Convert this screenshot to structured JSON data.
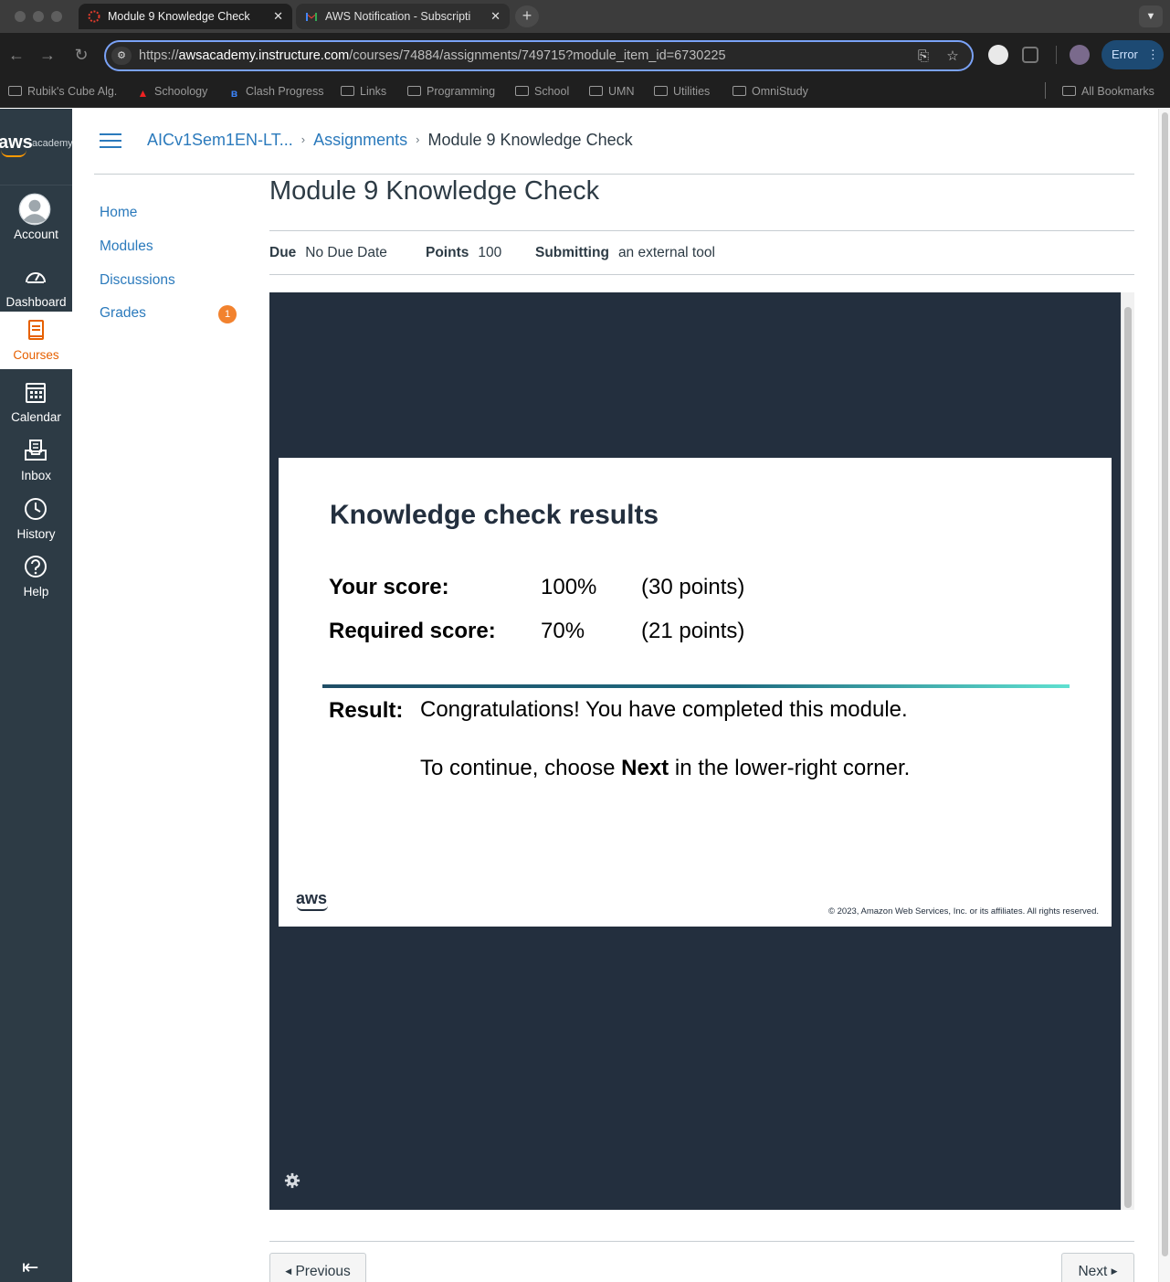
{
  "browser": {
    "tabs": [
      {
        "title": "Module 9 Knowledge Check",
        "active": true
      },
      {
        "title": "AWS Notification - Subscripti",
        "active": false
      }
    ],
    "url_prefix": "https://",
    "url_host": "awsacademy.instructure.com",
    "url_path": "/courses/74884/assignments/749715?module_item_id=6730225",
    "error_label": "Error",
    "bookmarks": [
      "Rubik's Cube Alg.",
      "Schoology",
      "Clash Progress",
      "Links",
      "Programming",
      "School",
      "UMN",
      "Utilities",
      "OmniStudy",
      "All Bookmarks"
    ]
  },
  "global_nav": {
    "logo_text": "aws",
    "logo_sub": "academy",
    "items": [
      {
        "label": "Account",
        "icon": "account-icon"
      },
      {
        "label": "Dashboard",
        "icon": "dashboard-icon"
      },
      {
        "label": "Courses",
        "icon": "courses-icon",
        "active": true
      },
      {
        "label": "Calendar",
        "icon": "calendar-icon"
      },
      {
        "label": "Inbox",
        "icon": "inbox-icon"
      },
      {
        "label": "History",
        "icon": "history-icon"
      },
      {
        "label": "Help",
        "icon": "help-icon"
      }
    ]
  },
  "breadcrumbs": {
    "course": "AICv1Sem1EN-LT...",
    "section": "Assignments",
    "current": "Module 9 Knowledge Check"
  },
  "course_nav": {
    "items": [
      "Home",
      "Modules",
      "Discussions",
      "Grades"
    ],
    "grades_badge": "1"
  },
  "assignment": {
    "title": "Module 9 Knowledge Check",
    "due_label": "Due",
    "due_value": "No Due Date",
    "points_label": "Points",
    "points_value": "100",
    "submitting_label": "Submitting",
    "submitting_value": "an external tool"
  },
  "results": {
    "heading": "Knowledge check results",
    "your_score_label": "Your score:",
    "your_score_pct": "100%",
    "your_score_points": "(30 points)",
    "required_label": "Required score:",
    "required_pct": "70%",
    "required_points": "(21 points)",
    "result_label": "Result:",
    "result_text": "Congratulations! You have completed this module.",
    "continue_before": "To continue, choose ",
    "continue_bold": "Next",
    "continue_after": " in the lower-right corner.",
    "logo_text": "aws",
    "copyright": "© 2023, Amazon Web Services, Inc. or its affiliates. All rights reserved."
  },
  "pager": {
    "previous": "Previous",
    "next": "Next"
  },
  "colors": {
    "canvas_nav": "#2d3b45",
    "link": "#2b7abc",
    "active_nav": "#e66000",
    "badge": "#f2822e",
    "lti_bg": "#232f3e"
  }
}
